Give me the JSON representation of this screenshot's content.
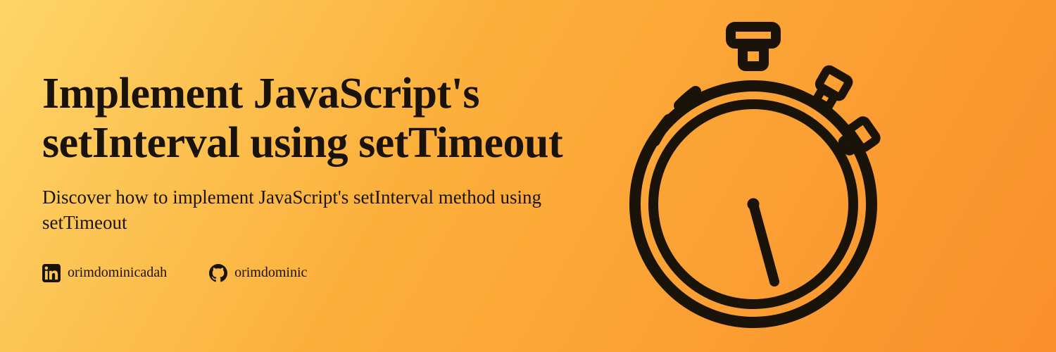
{
  "title": "Implement JavaScript's setInterval using setTimeout",
  "subtitle": "Discover how to implement JavaScript's setInterval method using setTimeout",
  "social": {
    "linkedin": {
      "handle": "orimdominicadah",
      "icon": "linkedin-icon"
    },
    "github": {
      "handle": "orimdominic",
      "icon": "github-icon"
    }
  },
  "illustration": {
    "name": "stopwatch-icon"
  },
  "colors": {
    "text": "#1a1309",
    "gradientStart": "#fdd568",
    "gradientEnd": "#fa8f2b"
  }
}
